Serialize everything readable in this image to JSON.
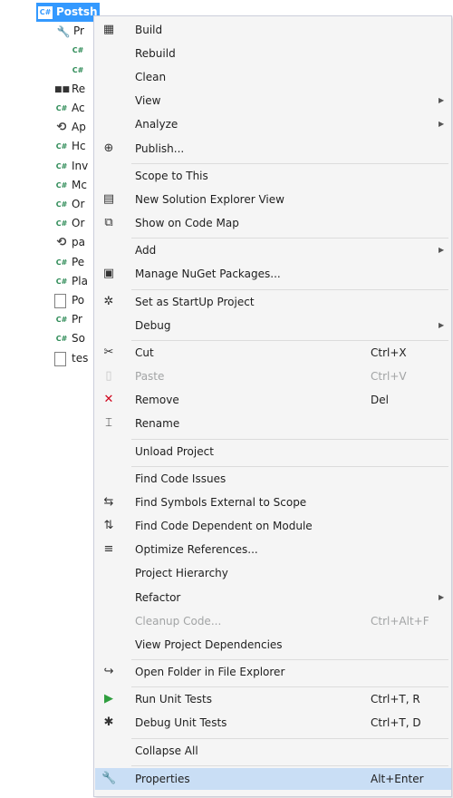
{
  "tree": {
    "items": [
      {
        "arrow": "◢",
        "icon": "C#",
        "label": "Postsh",
        "selected": true
      },
      {
        "arrow": "◢",
        "icon": "wrench",
        "label": "Pr"
      },
      {
        "arrow": "▷",
        "icon": "C#",
        "label": ""
      },
      {
        "arrow": "▷",
        "icon": "C#",
        "label": ""
      },
      {
        "arrow": "▷",
        "icon": "ref",
        "label": "Re"
      },
      {
        "arrow": "▷",
        "icon": "C#",
        "label": "Ac"
      },
      {
        "arrow": "",
        "icon": "cfg",
        "label": "Ap"
      },
      {
        "arrow": "▷",
        "icon": "C#",
        "label": "Hc"
      },
      {
        "arrow": "▷",
        "icon": "C#",
        "label": "Inv"
      },
      {
        "arrow": "▷",
        "icon": "C#",
        "label": "Mc"
      },
      {
        "arrow": "▷",
        "icon": "C#",
        "label": "Or"
      },
      {
        "arrow": "▷",
        "icon": "C#",
        "label": "Or"
      },
      {
        "arrow": "",
        "icon": "cfg",
        "label": "pa"
      },
      {
        "arrow": "▷",
        "icon": "C#",
        "label": "Pe"
      },
      {
        "arrow": "▷",
        "icon": "C#",
        "label": "Pla"
      },
      {
        "arrow": "",
        "icon": "file",
        "label": "Po"
      },
      {
        "arrow": "▷",
        "icon": "C#",
        "label": "Pr"
      },
      {
        "arrow": "▷",
        "icon": "C#",
        "label": "So"
      },
      {
        "arrow": "",
        "icon": "file",
        "label": "tes"
      }
    ]
  },
  "menu": {
    "items": [
      {
        "type": "item",
        "icon": "build-icon",
        "glyph": "▦",
        "label": "Build"
      },
      {
        "type": "item",
        "label": "Rebuild"
      },
      {
        "type": "item",
        "label": "Clean"
      },
      {
        "type": "item",
        "label": "View",
        "submenu": true
      },
      {
        "type": "item",
        "label": "Analyze",
        "submenu": true
      },
      {
        "type": "item",
        "icon": "publish-icon",
        "glyph": "⊕",
        "label": "Publish..."
      },
      {
        "type": "sep"
      },
      {
        "type": "item",
        "label": "Scope to This"
      },
      {
        "type": "item",
        "icon": "solution-explorer-icon",
        "glyph": "▤",
        "label": "New Solution Explorer View"
      },
      {
        "type": "item",
        "icon": "code-map-icon",
        "glyph": "⧉",
        "label": "Show on Code Map"
      },
      {
        "type": "sep"
      },
      {
        "type": "item",
        "label": "Add",
        "submenu": true
      },
      {
        "type": "item",
        "icon": "nuget-icon",
        "glyph": "▣",
        "label": "Manage NuGet Packages..."
      },
      {
        "type": "sep"
      },
      {
        "type": "item",
        "icon": "gear-icon",
        "glyph": "✲",
        "label": "Set as StartUp Project"
      },
      {
        "type": "item",
        "label": "Debug",
        "submenu": true
      },
      {
        "type": "sep"
      },
      {
        "type": "item",
        "icon": "scissors-icon",
        "glyph": "✂",
        "label": "Cut",
        "key": "Ctrl+X"
      },
      {
        "type": "item",
        "icon": "paste-icon",
        "glyph": "▯",
        "label": "Paste",
        "key": "Ctrl+V",
        "disabled": true
      },
      {
        "type": "item",
        "icon": "remove-icon",
        "glyph": "✕",
        "color": "#d0021b",
        "label": "Remove",
        "key": "Del"
      },
      {
        "type": "item",
        "icon": "rename-icon",
        "glyph": "⌶",
        "label": "Rename"
      },
      {
        "type": "sep"
      },
      {
        "type": "item",
        "label": "Unload Project"
      },
      {
        "type": "sep"
      },
      {
        "type": "item",
        "label": "Find Code Issues"
      },
      {
        "type": "item",
        "icon": "find-symbols-icon",
        "glyph": "⇆",
        "label": "Find Symbols External to Scope"
      },
      {
        "type": "item",
        "icon": "find-dependent-icon",
        "glyph": "⇅",
        "label": "Find Code Dependent on Module"
      },
      {
        "type": "item",
        "icon": "optimize-references-icon",
        "glyph": "≡",
        "label": "Optimize References..."
      },
      {
        "type": "item",
        "label": "Project Hierarchy"
      },
      {
        "type": "item",
        "label": "Refactor",
        "submenu": true
      },
      {
        "type": "item",
        "label": "Cleanup Code...",
        "key": "Ctrl+Alt+F",
        "disabled": true
      },
      {
        "type": "item",
        "label": "View Project Dependencies"
      },
      {
        "type": "sep"
      },
      {
        "type": "item",
        "icon": "open-folder-icon",
        "glyph": "↪",
        "label": "Open Folder in File Explorer"
      },
      {
        "type": "sep"
      },
      {
        "type": "item",
        "icon": "run-tests-icon",
        "glyph": "▶",
        "color": "#2e9e3e",
        "label": "Run Unit Tests",
        "key": "Ctrl+T, R"
      },
      {
        "type": "item",
        "icon": "debug-tests-icon",
        "glyph": "✱",
        "label": "Debug Unit Tests",
        "key": "Ctrl+T, D"
      },
      {
        "type": "sep"
      },
      {
        "type": "item",
        "label": "Collapse All"
      },
      {
        "type": "sep"
      },
      {
        "type": "item",
        "icon": "wrench-icon",
        "glyph": "🔧",
        "label": "Properties",
        "key": "Alt+Enter",
        "highlight": true
      }
    ]
  }
}
